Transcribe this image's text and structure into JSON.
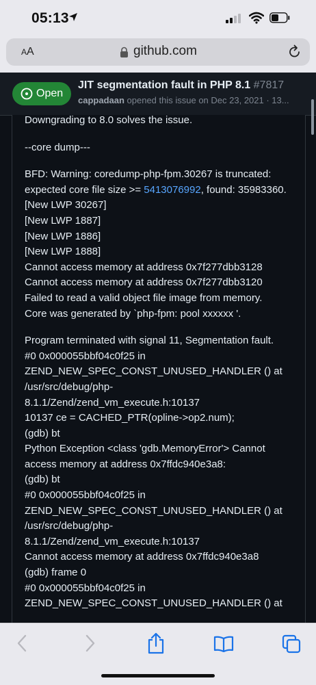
{
  "status_bar": {
    "time": "05:13"
  },
  "url_bar": {
    "text_size_small": "A",
    "text_size_large": "A",
    "domain": "github.com"
  },
  "issue": {
    "state": "Open",
    "title": "JIT segmentation fault in PHP 8.1",
    "number": "#7817",
    "author": "cappadaan",
    "meta": " opened this issue on Dec 23, 2021 · 13..."
  },
  "comment": {
    "p1": "Downgrading to 8.0 solves the issue.",
    "p2": "--core dump---",
    "p3_pre": "BFD: Warning: coredump-php-fpm.30267 is truncated: expected core file size >= ",
    "p3_link": "5413076992",
    "p3_post": ", found: 35983360.",
    "lines": [
      "[New LWP 30267]",
      "[New LWP 1887]",
      "[New LWP 1886]",
      "[New LWP 1888]",
      "Cannot access memory at address 0x7f277dbb3128",
      "Cannot access memory at address 0x7f277dbb3120",
      "Failed to read a valid object file image from memory.",
      "Core was generated by `php-fpm: pool xxxxxx '."
    ],
    "lines2": [
      "Program terminated with signal 11, Segmentation fault.",
      "#0 0x000055bbf04c0f25 in",
      "ZEND_NEW_SPEC_CONST_UNUSED_HANDLER () at",
      "/usr/src/debug/php-",
      "8.1.1/Zend/zend_vm_execute.h:10137",
      "10137 ce = CACHED_PTR(opline->op2.num);",
      "(gdb) bt",
      "Python Exception <class 'gdb.MemoryError'> Cannot",
      "access memory at address 0x7ffdc940e3a8:",
      "(gdb) bt",
      "#0 0x000055bbf04c0f25 in",
      "ZEND_NEW_SPEC_CONST_UNUSED_HANDLER () at",
      "/usr/src/debug/php-",
      "8.1.1/Zend/zend_vm_execute.h:10137",
      "Cannot access memory at address 0x7ffdc940e3a8",
      "(gdb) frame 0",
      "#0 0x000055bbf04c0f25 in",
      "ZEND_NEW_SPEC_CONST_UNUSED_HANDLER () at"
    ]
  },
  "colors": {
    "open_green": "#238636",
    "link_blue": "#58a6ff",
    "background": "#0d1117"
  }
}
